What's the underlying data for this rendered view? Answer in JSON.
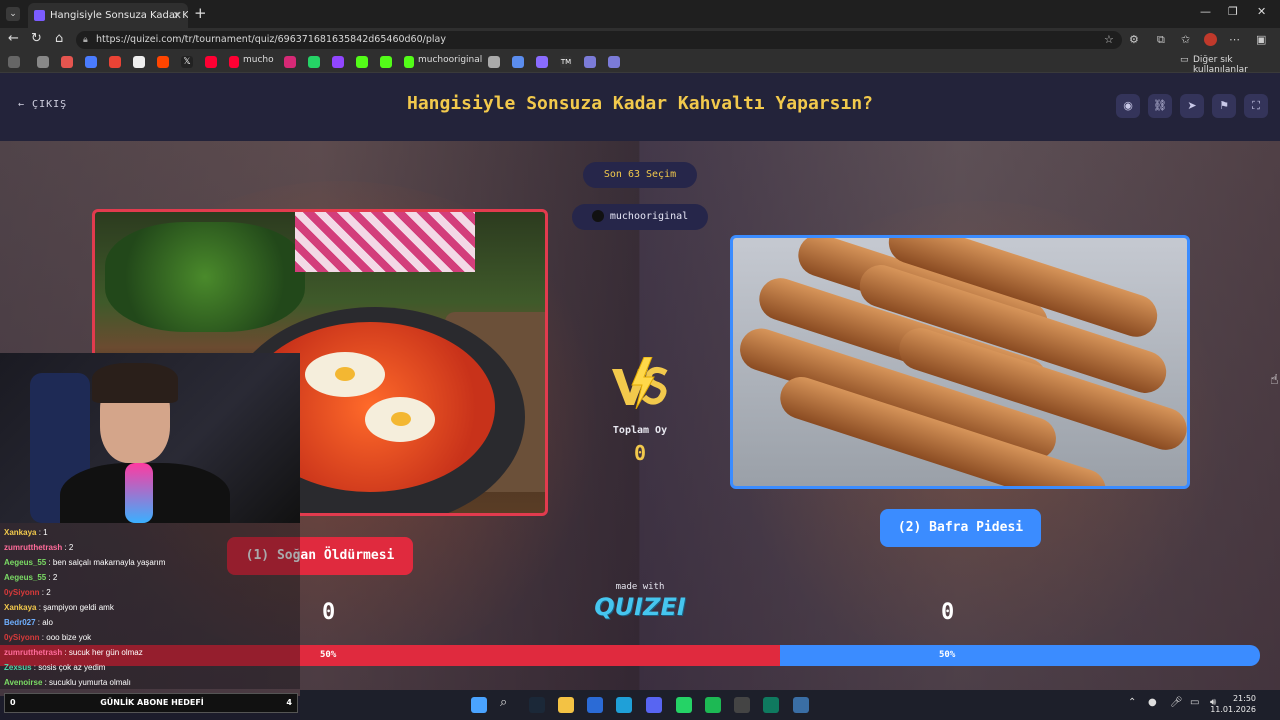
{
  "browser": {
    "tab_title": "Hangisiyle Sonsuza Kadar Kahvalt",
    "tab_close": "✕",
    "new_tab": "+",
    "url": "https://quizei.com/tr/tournament/quiz/696371681635842d65460d60/play",
    "window_controls": [
      "—",
      "❐",
      "✕"
    ],
    "bookmarks": [
      {
        "label": "mucho",
        "color": "#ff0033"
      },
      {
        "label": "muchooriginal",
        "color": "#53fc18"
      }
    ],
    "other_bookmarks": "Diğer sık kullanılanlar"
  },
  "quiz": {
    "exit_label": "ÇIKIŞ",
    "title": "Hangisiyle Sonsuza Kadar Kahvaltı Yaparsın?",
    "round_label": "Son 63 Seçim",
    "username": "muchooriginal",
    "total_votes_label": "Toplam Oy",
    "total_votes": "0",
    "left": {
      "label": "(1) Soğan Öldürmesi",
      "score": "0",
      "percent": "50%",
      "share": 0.5
    },
    "right": {
      "label": "(2) Bafra Pidesi",
      "score": "0",
      "percent": "50%",
      "share": 0.5
    },
    "made_with": "made with",
    "brand": "QUIZEI",
    "accent_left": "#e02a3e",
    "accent_right": "#3b8cff",
    "title_color": "#f2c94c"
  },
  "stream": {
    "chat": [
      {
        "user": "Xankaya",
        "text": " : 1",
        "color": "#f2c94c"
      },
      {
        "user": "zumrutthetrash",
        "text": " : 2",
        "color": "#ff6b9a"
      },
      {
        "user": "Aegeus_55",
        "text": " : ben salçalı makarnayla yaşarım",
        "color": "#7bdc65"
      },
      {
        "user": "Aegeus_55",
        "text": " : 2",
        "color": "#7bdc65"
      },
      {
        "user": "0ySiyonn",
        "text": " : 2",
        "color": "#d83a3a"
      },
      {
        "user": "Xankaya",
        "text": " : şampiyon geldi amk",
        "color": "#f2c94c"
      },
      {
        "user": "Bedr027",
        "text": " : alo",
        "color": "#6fb0ff"
      },
      {
        "user": "0ySiyonn",
        "text": " : ooo bize yok",
        "color": "#d83a3a"
      },
      {
        "user": "zumrutthetrash",
        "text": " : sucuk her gün olmaz",
        "color": "#ff6b9a"
      },
      {
        "user": "Zexsus",
        "text": " : sosis çok az yedim",
        "color": "#4fd1a5"
      },
      {
        "user": "Avenoirse",
        "text": " : sucuklu yumurta olmalı",
        "color": "#7bdc65"
      }
    ],
    "sub_goal": {
      "current": "0",
      "label": "GÜNLİK ABONE HEDEFİ",
      "target": "4"
    }
  },
  "taskbar": {
    "time": "21:50",
    "date": "11.01.2026"
  }
}
